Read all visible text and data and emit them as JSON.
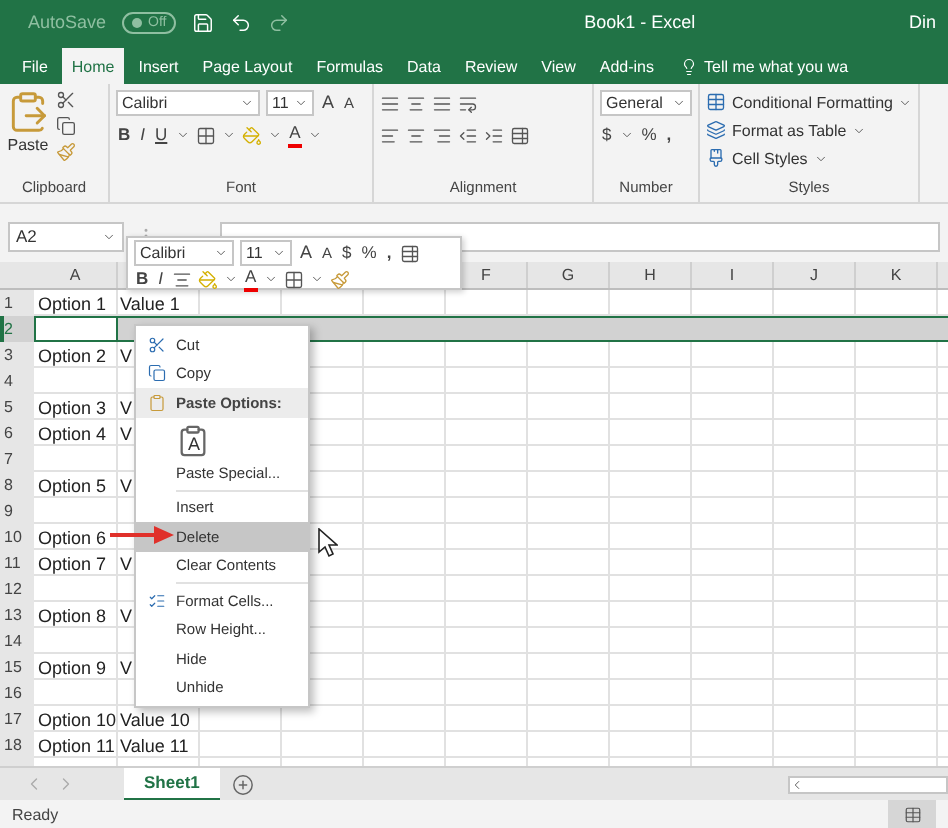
{
  "title_bar": {
    "autosave": {
      "label": "AutoSave",
      "state": "Off",
      "on": false
    },
    "title": "Book1  -  Excel",
    "user": "Din"
  },
  "tabs": [
    {
      "label": "File",
      "selected": false
    },
    {
      "label": "Home",
      "selected": true
    },
    {
      "label": "Insert",
      "selected": false
    },
    {
      "label": "Page Layout",
      "selected": false
    },
    {
      "label": "Formulas",
      "selected": false
    },
    {
      "label": "Data",
      "selected": false
    },
    {
      "label": "Review",
      "selected": false
    },
    {
      "label": "View",
      "selected": false
    },
    {
      "label": "Add-ins",
      "selected": false
    }
  ],
  "tell_me": "Tell me what you wa",
  "ribbon": {
    "clipboard": {
      "label": "Clipboard",
      "paste": "Paste"
    },
    "font": {
      "label": "Font",
      "name": "Calibri",
      "size": "11",
      "grow": "A",
      "shrink": "A",
      "bold": "B",
      "italic": "I",
      "underline": "U",
      "color_glyph": "A"
    },
    "alignment": {
      "label": "Alignment"
    },
    "number": {
      "label": "Number",
      "format": "General",
      "currency": "$",
      "percent": "%",
      "comma": ","
    },
    "styles": {
      "label": "Styles",
      "items": [
        "Conditional Formatting",
        "Format as Table",
        "Cell Styles"
      ]
    }
  },
  "name_box": "A2",
  "columns": [
    "A",
    "F",
    "G",
    "H",
    "I",
    "J",
    "K"
  ],
  "rows": [
    {
      "number": "1",
      "selected": false,
      "a": "Option 1",
      "b": "Value 1"
    },
    {
      "number": "2",
      "selected": true
    },
    {
      "number": "3",
      "selected": false,
      "a": "Option 2",
      "b": "V"
    },
    {
      "number": "4",
      "selected": false
    },
    {
      "number": "5",
      "selected": false,
      "a": "Option 3",
      "b": "V"
    },
    {
      "number": "6",
      "selected": false,
      "a": "Option 4",
      "b": "V"
    },
    {
      "number": "7",
      "selected": false
    },
    {
      "number": "8",
      "selected": false,
      "a": "Option 5",
      "b": "V"
    },
    {
      "number": "9",
      "selected": false
    },
    {
      "number": "10",
      "selected": false,
      "a": "Option 6"
    },
    {
      "number": "11",
      "selected": false,
      "a": "Option 7",
      "b": "V"
    },
    {
      "number": "12",
      "selected": false
    },
    {
      "number": "13",
      "selected": false,
      "a": "Option 8",
      "b": "V"
    },
    {
      "number": "14",
      "selected": false
    },
    {
      "number": "15",
      "selected": false,
      "a": "Option 9",
      "b": "V"
    },
    {
      "number": "16",
      "selected": false
    },
    {
      "number": "17",
      "selected": false,
      "a": "Option 10",
      "b": "Value 10"
    },
    {
      "number": "18",
      "selected": false,
      "a": "Option 11",
      "b": "Value 11"
    }
  ],
  "mini_toolbar": {
    "font": "Calibri",
    "size": "11",
    "grow": "A",
    "shrink": "A",
    "currency": "$",
    "percent": "%",
    "comma": ",",
    "bold": "B",
    "italic": "I",
    "color_glyph": "A"
  },
  "context_menu": [
    {
      "kind": "item",
      "label": "Cut",
      "selected": false
    },
    {
      "kind": "item",
      "label": "Copy",
      "selected": false
    },
    {
      "kind": "header",
      "label": "Paste Options:"
    },
    {
      "kind": "paste-icon",
      "glyph": "A",
      "selected": false
    },
    {
      "kind": "item",
      "label": "Paste Special...",
      "selected": false
    },
    {
      "kind": "separator"
    },
    {
      "kind": "item",
      "label": "Insert",
      "selected": false
    },
    {
      "kind": "item",
      "label": "Delete",
      "selected": true
    },
    {
      "kind": "item",
      "label": "Clear Contents",
      "selected": false
    },
    {
      "kind": "separator"
    },
    {
      "kind": "item",
      "label": "Format Cells...",
      "selected": false
    },
    {
      "kind": "item",
      "label": "Row Height...",
      "selected": false
    },
    {
      "kind": "item",
      "label": "Hide",
      "selected": false
    },
    {
      "kind": "item",
      "label": "Unhide",
      "selected": false
    }
  ],
  "sheet_tabs": [
    {
      "label": "Sheet1",
      "selected": true
    }
  ],
  "status": "Ready"
}
